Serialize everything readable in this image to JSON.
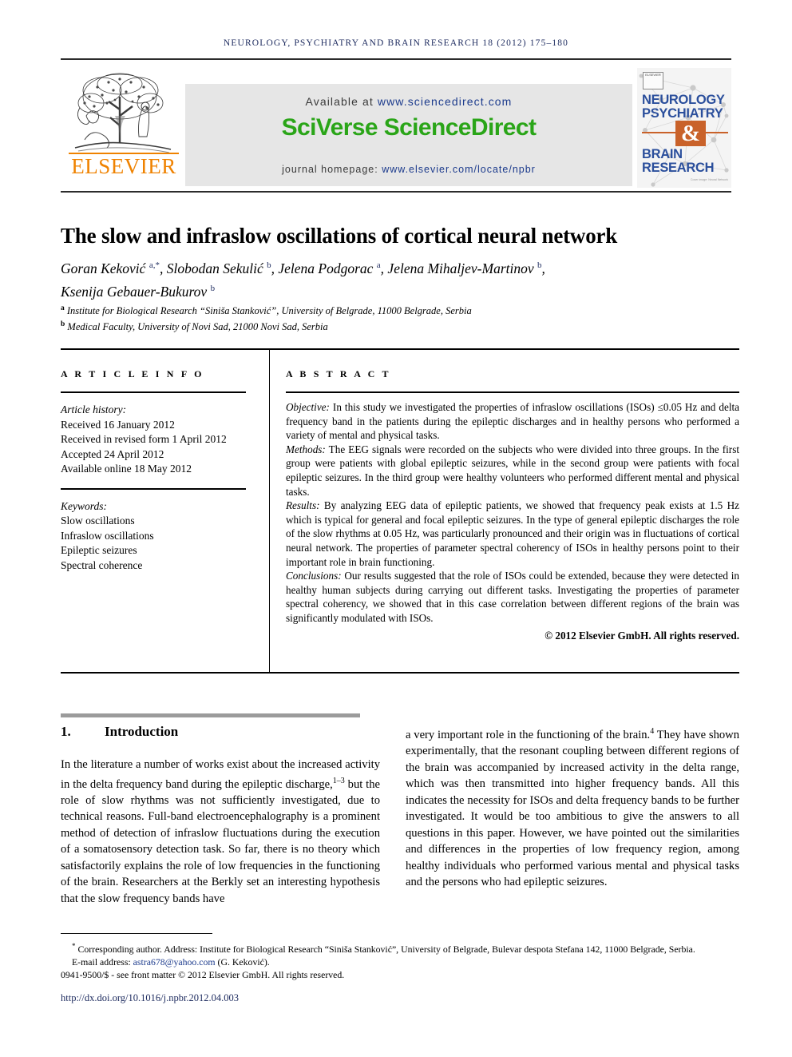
{
  "running_head": "NEUROLOGY, PSYCHIATRY AND BRAIN RESEARCH 18 (2012) 175–180",
  "masthead": {
    "publisher_name": "ELSEVIER",
    "available_prefix": "Available at",
    "available_url": "www.sciencedirect.com",
    "platform_logo": "SciVerse ScienceDirect",
    "homepage_prefix": "journal homepage:",
    "homepage_url": "www.elsevier.com/locate/npbr",
    "cover": {
      "line1": "NEUROLOGY",
      "line2": "PSYCHIATRY",
      "ampersand": "&",
      "line3": "BRAIN",
      "line4": "RESEARCH",
      "mini_logo_text": "ELSEVIER",
      "credit": "Cover image: Neural Network"
    },
    "colors": {
      "elsevier_orange": "#ef8200",
      "sciencedirect_green": "#2aa518",
      "link_blue": "#1b3a8c",
      "cover_blue": "#2b4f9c",
      "cover_orange": "#c9622a",
      "panel_gray": "#e6e6e6"
    }
  },
  "article": {
    "title": "The slow and infraslow oscillations of cortical neural network",
    "authors_line1_parts": [
      {
        "name": "Goran Keković",
        "sup": "a,*",
        "sep": ", "
      },
      {
        "name": "Slobodan Sekulić",
        "sup": "b",
        "sep": ", "
      },
      {
        "name": "Jelena Podgorac",
        "sup": "a",
        "sep": ", "
      },
      {
        "name": "Jelena Mihaljev-Martinov",
        "sup": "b",
        "sep": ","
      }
    ],
    "authors_line2_parts": [
      {
        "name": "Ksenija Gebauer-Bukurov",
        "sup": "b",
        "sep": ""
      }
    ],
    "affiliations": [
      {
        "marker": "a",
        "text": "Institute for Biological Research “Siniša Stanković”, University of Belgrade, 11000 Belgrade, Serbia"
      },
      {
        "marker": "b",
        "text": "Medical Faculty, University of Novi Sad, 21000 Novi Sad, Serbia"
      }
    ]
  },
  "article_info": {
    "heading": "A R T I C L E   I N F O",
    "history_label": "Article history:",
    "history": [
      "Received 16 January 2012",
      "Received in revised form 1 April 2012",
      "Accepted 24 April 2012",
      "Available online 18 May 2012"
    ],
    "keywords_label": "Keywords:",
    "keywords": [
      "Slow oscillations",
      "Infraslow oscillations",
      "Epileptic seizures",
      "Spectral coherence"
    ]
  },
  "abstract": {
    "heading": "A B S T R A C T",
    "objective_label": "Objective:",
    "objective_text": " In this study we investigated the properties of infraslow oscillations (ISOs) ≤0.05 Hz and delta frequency band in the patients during the epileptic discharges and in healthy persons who performed a variety of mental and physical tasks.",
    "methods_label": "Methods:",
    "methods_text": " The EEG signals were recorded on the subjects who were divided into three groups. In the first group were patients with global epileptic seizures, while in the second group were patients with focal epileptic seizures. In the third group were healthy volunteers who performed different mental and physical tasks.",
    "results_label": "Results:",
    "results_text": " By analyzing EEG data of epileptic patients, we showed that frequency peak exists at 1.5 Hz which is typical for general and focal epileptic seizures. In the type of general epileptic discharges the role of the slow rhythms at 0.05 Hz, was particularly pronounced and their origin was in fluctuations of cortical neural network. The properties of parameter spectral coherency of ISOs in healthy persons point to their important role in brain functioning.",
    "conclusions_label": "Conclusions:",
    "conclusions_text": " Our results suggested that the role of ISOs could be extended, because they were detected in healthy human subjects during carrying out different tasks. Investigating the properties of parameter spectral coherency, we showed that in this case correlation between different regions of the brain was significantly modulated with ISOs.",
    "copyright": "© 2012 Elsevier GmbH. All rights reserved."
  },
  "body": {
    "section_number": "1.",
    "section_title": "Introduction",
    "left_column_part1": "In the literature a number of works exist about the increased activity in the delta frequency band during the epileptic discharge,",
    "left_column_cite": "1–3",
    "left_column_part2": " but the role of slow rhythms was not sufficiently investigated, due to technical reasons. Full-band electroencephalography is a prominent method of detection of infraslow fluctuations during the execution of a somatosensory detection task. So far, there is no theory which satisfactorily explains the role of low frequencies in the functioning of the brain. Researchers at the Berkly set an interesting hypothesis that the slow frequency bands have",
    "right_column_part1": "a very important role in the functioning of the brain.",
    "right_column_cite": "4",
    "right_column_part2": " They have shown experimentally, that the resonant coupling between different regions of the brain was accompanied by increased activity in the delta range, which was then transmitted into higher frequency bands. All this indicates the necessity for ISOs and delta frequency bands to be further investigated. It would be too ambitious to give the answers to all questions in this paper. However, we have pointed out the similarities and differences in the properties of low frequency region, among healthy individuals who performed various mental and physical tasks and the persons who had epileptic seizures."
  },
  "footer": {
    "corresponding_marker": "*",
    "corresponding_text": " Corresponding author. Address: Institute for Biological Research “Siniša Stanković”, University of Belgrade, Bulevar despota Stefana 142, 11000 Belgrade, Serbia.",
    "email_label": "E-mail address:",
    "email_address": "astra678@yahoo.com",
    "email_owner": "(G. Keković).",
    "issn_line": "0941-9500/$ - see front matter © 2012 Elsevier GmbH. All rights reserved.",
    "doi_url": "http://dx.doi.org/10.1016/j.npbr.2012.04.003"
  }
}
